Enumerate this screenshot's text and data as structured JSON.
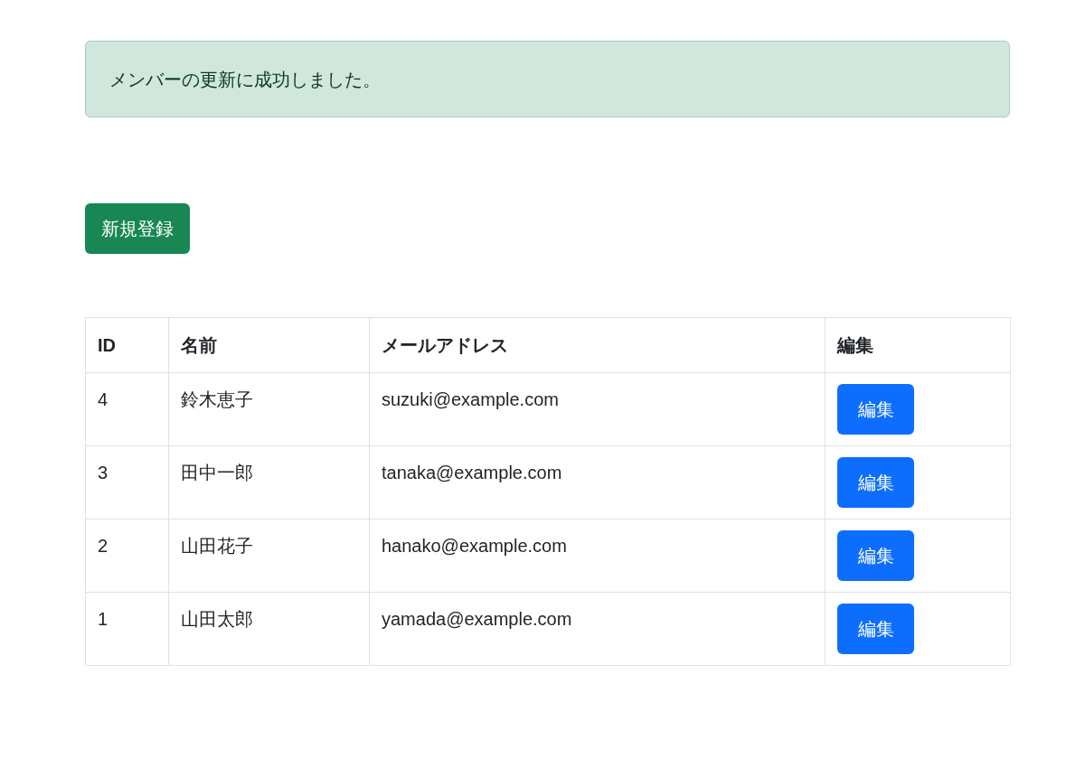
{
  "alert": {
    "message": "メンバーの更新に成功しました。"
  },
  "new_button": {
    "label": "新規登録"
  },
  "table": {
    "columns": [
      "ID",
      "名前",
      "メールアドレス",
      "編集"
    ],
    "rows": [
      {
        "id": "4",
        "name": "鈴木恵子",
        "email": "suzuki@example.com",
        "action": "編集"
      },
      {
        "id": "3",
        "name": "田中一郎",
        "email": "tanaka@example.com",
        "action": "編集"
      },
      {
        "id": "2",
        "name": "山田花子",
        "email": "hanako@example.com",
        "action": "編集"
      },
      {
        "id": "1",
        "name": "山田太郎",
        "email": "yamada@example.com",
        "action": "編集"
      }
    ]
  }
}
